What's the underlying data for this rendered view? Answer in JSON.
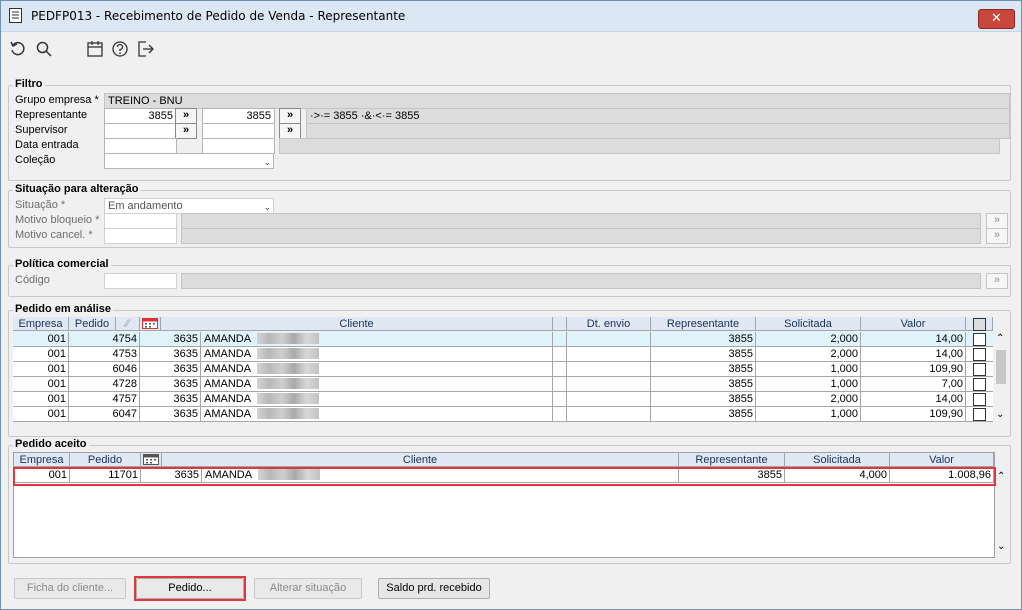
{
  "window": {
    "title": "PEDFP013 - Recebimento de Pedido de Venda - Representante",
    "close_label": "✕"
  },
  "toolbar": {
    "icons": [
      "refresh-icon",
      "search-icon",
      "calendar-icon",
      "help-icon",
      "exit-icon"
    ]
  },
  "filtro": {
    "title": "Filtro",
    "grupo_label": "Grupo empresa *",
    "grupo_value": "TREINO - BNU",
    "representante_label": "Representante",
    "rep_from": "3855",
    "rep_to": "3855",
    "rep_expr": "·>·= 3855 ·&·<·= 3855",
    "supervisor_label": "Supervisor",
    "data_entrada_label": "Data entrada",
    "colecao_label": "Coleção",
    "picker_label": "»"
  },
  "situacao": {
    "title": "Situação para alteração",
    "situacao_label": "Situação *",
    "situacao_value": "Em andamento",
    "motivo_bloqueio_label": "Motivo bloqueio *",
    "motivo_cancel_label": "Motivo cancel. *",
    "picker_label": "»"
  },
  "politica": {
    "title": "Política comercial",
    "codigo_label": "Código",
    "picker_label": "»"
  },
  "pedido_analise": {
    "title": "Pedido em análise",
    "columns": {
      "empresa": "Empresa",
      "pedido": "Pedido",
      "cliente": "Cliente",
      "dt_envio": "Dt. envio",
      "representante": "Representante",
      "solicitada": "Solicitada",
      "valor": "Valor"
    },
    "rows": [
      {
        "empresa": "001",
        "pedido": "4754",
        "cliente_cod": "3635",
        "cliente_nome": "AMANDA",
        "representante": "3855",
        "solicitada": "2,000",
        "valor": "14,00"
      },
      {
        "empresa": "001",
        "pedido": "4753",
        "cliente_cod": "3635",
        "cliente_nome": "AMANDA",
        "representante": "3855",
        "solicitada": "2,000",
        "valor": "14,00"
      },
      {
        "empresa": "001",
        "pedido": "6046",
        "cliente_cod": "3635",
        "cliente_nome": "AMANDA",
        "representante": "3855",
        "solicitada": "1,000",
        "valor": "109,90"
      },
      {
        "empresa": "001",
        "pedido": "4728",
        "cliente_cod": "3635",
        "cliente_nome": "AMANDA",
        "representante": "3855",
        "solicitada": "1,000",
        "valor": "7,00"
      },
      {
        "empresa": "001",
        "pedido": "4757",
        "cliente_cod": "3635",
        "cliente_nome": "AMANDA",
        "representante": "3855",
        "solicitada": "2,000",
        "valor": "14,00"
      },
      {
        "empresa": "001",
        "pedido": "6047",
        "cliente_cod": "3635",
        "cliente_nome": "AMANDA",
        "representante": "3855",
        "solicitada": "1,000",
        "valor": "109,90"
      }
    ]
  },
  "pedido_aceito": {
    "title": "Pedido aceito",
    "columns": {
      "empresa": "Empresa",
      "pedido": "Pedido",
      "cliente": "Cliente",
      "representante": "Representante",
      "solicitada": "Solicitada",
      "valor": "Valor"
    },
    "rows": [
      {
        "empresa": "001",
        "pedido": "11701",
        "cliente_cod": "3635",
        "cliente_nome": "AMANDA",
        "representante": "3855",
        "solicitada": "4,000",
        "valor": "1.008,96"
      }
    ]
  },
  "buttons": {
    "ficha": "Ficha do cliente...",
    "pedido": "Pedido...",
    "alterar": "Alterar situação",
    "saldo": "Saldo prd. recebido"
  },
  "colors": {
    "highlight_border": "#e0373f",
    "selected_row": "#dff3fb"
  }
}
